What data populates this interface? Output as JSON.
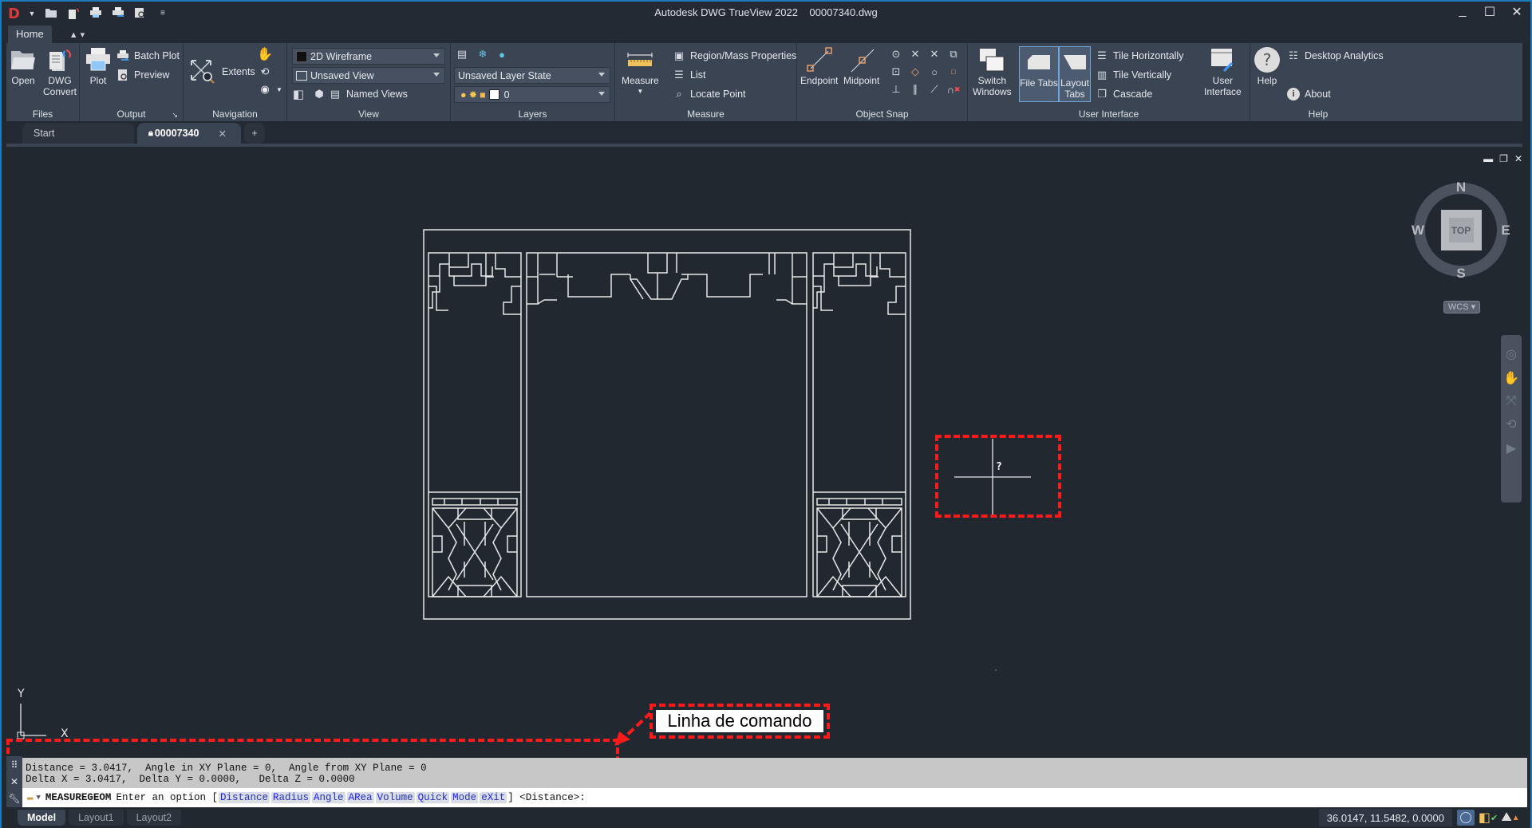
{
  "window": {
    "title": "Autodesk DWG TrueView 2022",
    "filename": "00007340.dwg",
    "app_logo": "D",
    "controls": {
      "minimize": "_",
      "maximize": "☐",
      "close": "✕"
    }
  },
  "quick_access": [
    "open-icon",
    "dwg-convert-icon",
    "plot-icon",
    "batch-plot-icon",
    "preview-icon",
    "customize-dropdown-icon"
  ],
  "ribbon": {
    "tabs": [
      {
        "label": "Home",
        "active": true
      },
      {
        "label": "▲ ▾",
        "active": false
      }
    ],
    "panels": {
      "files": {
        "label": "Files",
        "open": "Open",
        "dwg_convert_1": "DWG",
        "dwg_convert_2": "Convert"
      },
      "output": {
        "label": "Output",
        "plot": "Plot",
        "batch_plot": "Batch Plot",
        "preview": "Preview",
        "launcher": "↘"
      },
      "navigation": {
        "label": "Navigation",
        "extents": "Extents"
      },
      "view": {
        "label": "View",
        "visual_style": "2D Wireframe",
        "named_view": "Unsaved View",
        "named_views": "Named Views"
      },
      "layers": {
        "label": "Layers",
        "layer_state": "Unsaved Layer State",
        "current_layer": "0"
      },
      "measure": {
        "label": "Measure",
        "measure": "Measure",
        "region_mass": "Region/Mass Properties",
        "list": "List",
        "locate_point": "Locate Point"
      },
      "object_snap": {
        "label": "Object Snap",
        "endpoint": "Endpoint",
        "midpoint": "Midpoint"
      },
      "user_interface": {
        "label": "User Interface",
        "switch_windows_1": "Switch",
        "switch_windows_2": "Windows",
        "file_tabs": "File Tabs",
        "layout_tabs_1": "Layout",
        "layout_tabs_2": "Tabs",
        "tile_h": "Tile Horizontally",
        "tile_v": "Tile Vertically",
        "cascade": "Cascade",
        "user_interface_1": "User",
        "user_interface_2": "Interface"
      },
      "help": {
        "label": "Help",
        "help": "Help",
        "desktop_analytics": "Desktop Analytics",
        "about": "About"
      }
    }
  },
  "file_tabs": {
    "start": "Start",
    "active": "00007340",
    "close": "✕",
    "new": "+"
  },
  "viewport": {
    "controls": {
      "minimize": "▬",
      "restore": "❐",
      "close": "✕"
    },
    "viewcube": {
      "n": "N",
      "s": "S",
      "e": "E",
      "w": "W",
      "face": "TOP"
    },
    "wcs_label": "WCS ▾",
    "ucs": {
      "x": "X",
      "y": "Y"
    },
    "cursor_tooltip": "?",
    "annotation_label": "Linha de comando"
  },
  "command_line": {
    "history": [
      "Distance = 3.0417,  Angle in XY Plane = 0,  Angle from XY Plane = 0",
      "Delta X = 3.0417,  Delta Y = 0.0000,   Delta Z = 0.0000"
    ],
    "command": "MEASUREGEOM",
    "prompt": "Enter an option [",
    "options": [
      {
        "key": "D",
        "rest": "istance"
      },
      {
        "key": "R",
        "rest": "adius"
      },
      {
        "key": "A",
        "rest": "ngle"
      },
      {
        "key": "AR",
        "rest": "ea"
      },
      {
        "key": "V",
        "rest": "olume"
      },
      {
        "key": "Q",
        "rest": "uick"
      },
      {
        "key": "M",
        "rest": "ode"
      },
      {
        "key": "X",
        "pre": "e",
        "rest": "it"
      }
    ],
    "suffix": "] <Distance>:"
  },
  "status_bar": {
    "layout_tabs": [
      {
        "label": "Model",
        "active": true
      },
      {
        "label": "Layout1",
        "active": false
      },
      {
        "label": "Layout2",
        "active": false
      }
    ],
    "coordinates": "36.0147, 11.5482, 0.0000"
  },
  "colors": {
    "accent": "#1b7bbd",
    "annotation": "#ff1a1a",
    "ribbon": "#3b4453",
    "canvas": "#212830"
  }
}
